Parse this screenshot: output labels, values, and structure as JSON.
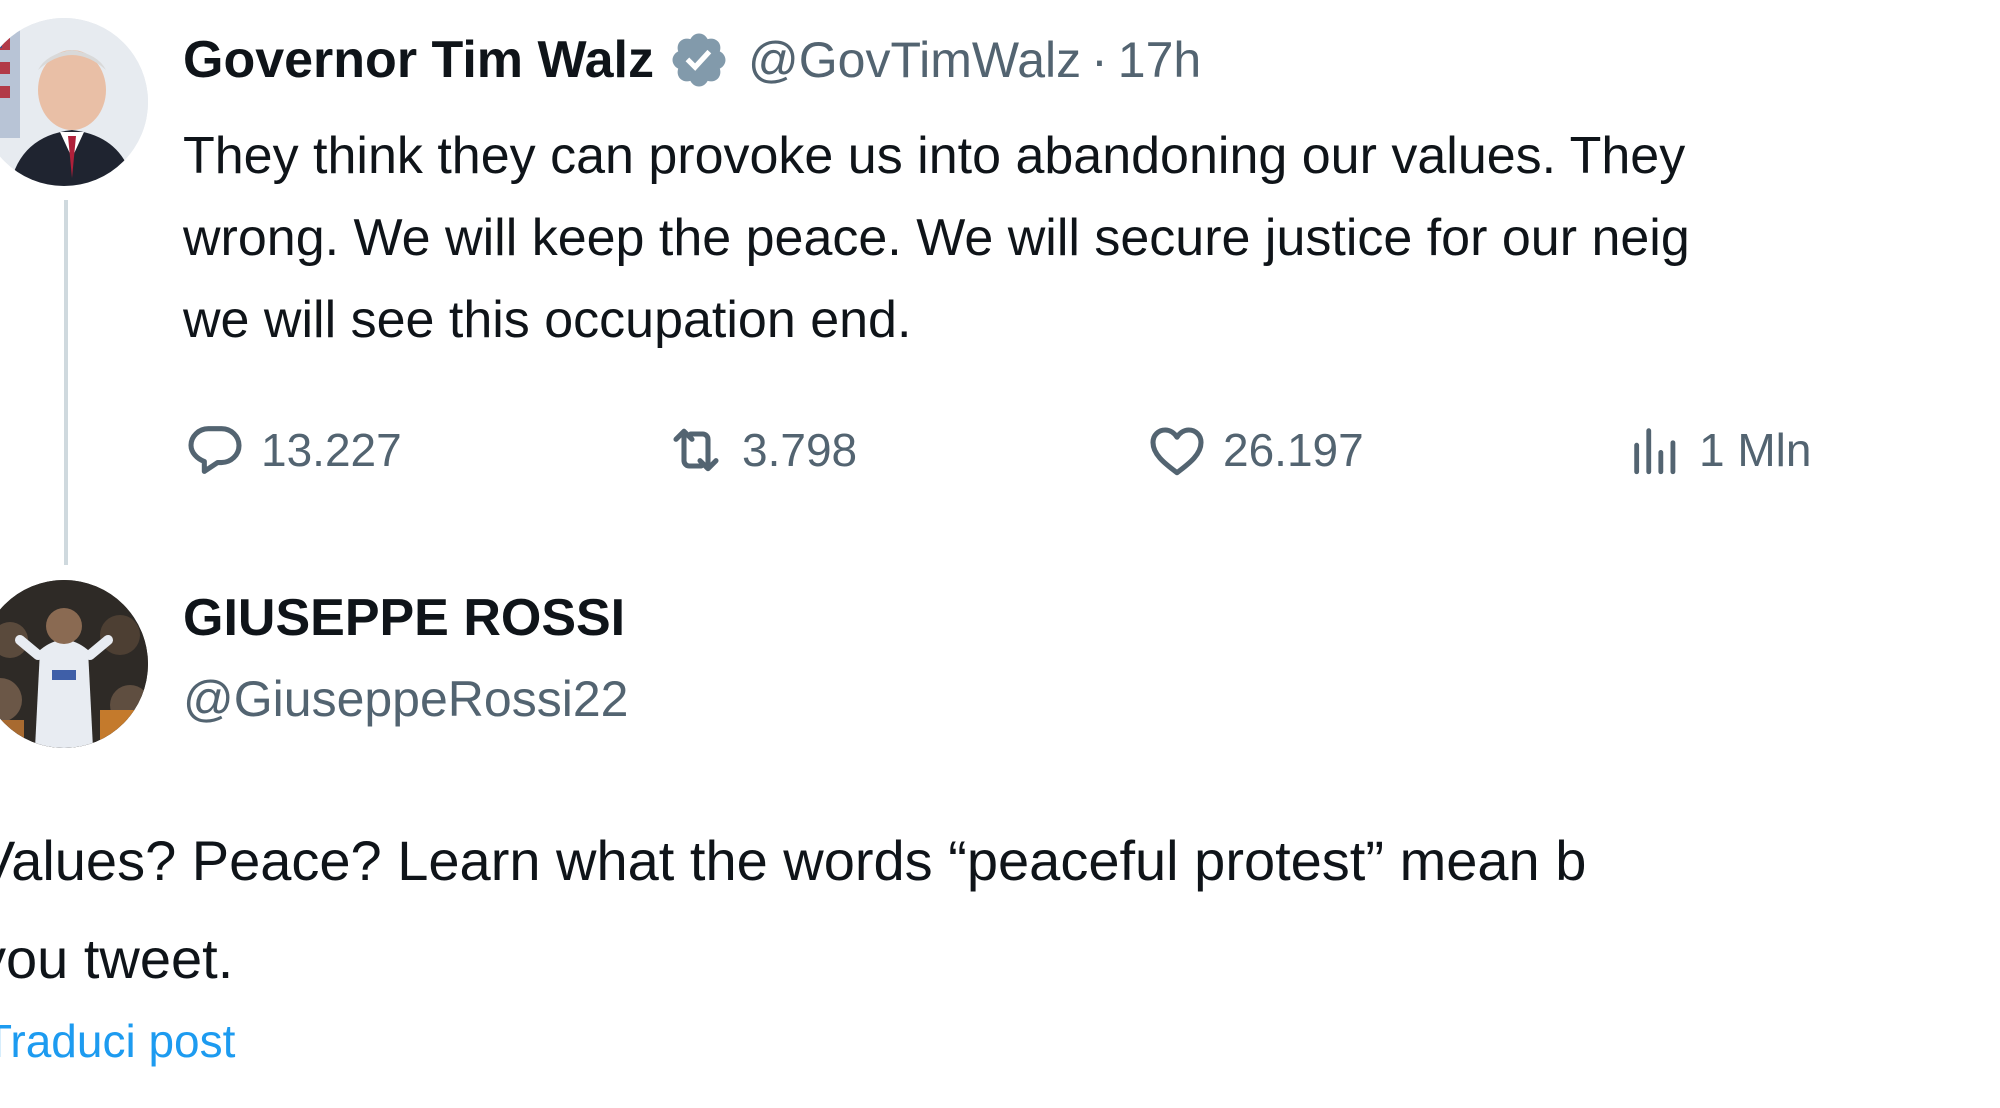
{
  "original_post": {
    "author_name": "Governor Tim Walz",
    "verified_icon": "verified-badge-icon",
    "handle": "@GovTimWalz",
    "separator": "·",
    "time": "17h",
    "text_lines": [
      "They think they can provoke us into abandoning our values. They",
      "wrong. We will keep the peace. We will secure justice for our neig",
      "we will see this occupation end."
    ],
    "actions": {
      "replies": "13.227",
      "reposts": "3.798",
      "likes": "26.197",
      "views": "1 Mln"
    },
    "icons": {
      "reply": "reply-icon",
      "repost": "repost-icon",
      "like": "heart-icon",
      "views": "views-icon"
    }
  },
  "reply_post": {
    "author_name": "GIUSEPPE ROSSI",
    "handle": "@GiuseppeRossi22",
    "text_lines": [
      "Values? Peace? Learn what the words “peaceful protest” mean b",
      "you tweet."
    ],
    "translate_label": "Traduci post"
  },
  "colors": {
    "text_primary": "#0f1419",
    "text_secondary": "#536471",
    "link": "#1d9bf0",
    "verified": "#829aab",
    "thread_line": "#cfd9de"
  }
}
